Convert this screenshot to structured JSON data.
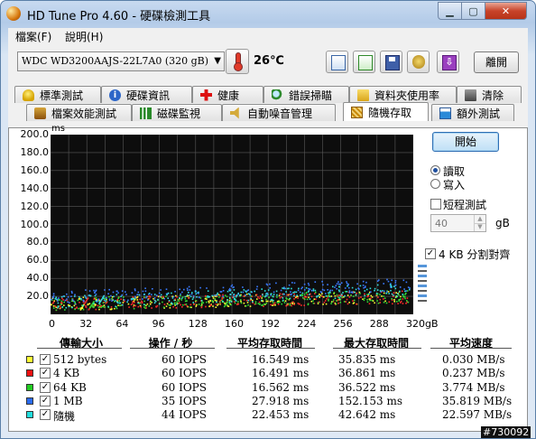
{
  "window": {
    "title": "HD Tune Pro 4.60 - 硬碟檢測工具"
  },
  "menu": [
    {
      "label": "檔案(F)"
    },
    {
      "label": "說明(H)"
    }
  ],
  "toolbar": {
    "drive": "WDC WD3200AAJS-22L7A0   (320 gB)",
    "temperature": "26℃",
    "exit_label": "離開",
    "icons": [
      "copy-text-icon",
      "copy-screenshot-icon",
      "save-icon",
      "options-icon",
      "download-icon"
    ]
  },
  "tabs_row1": [
    {
      "label": "標準測試",
      "icon": "bulb-icon"
    },
    {
      "label": "硬碟資訊",
      "icon": "info-icon"
    },
    {
      "label": "健康",
      "icon": "health-cross-icon"
    },
    {
      "label": "錯誤掃瞄",
      "icon": "scan-icon"
    },
    {
      "label": "資料夾使用率",
      "icon": "folder-icon"
    },
    {
      "label": "清除",
      "icon": "trash-icon"
    }
  ],
  "tabs_row2": [
    {
      "label": "檔案效能測試",
      "icon": "benchmark-icon"
    },
    {
      "label": "磁碟監視",
      "icon": "monitor-icon"
    },
    {
      "label": "自動噪音管理",
      "icon": "speaker-icon"
    },
    {
      "label": "隨機存取",
      "icon": "random-access-icon",
      "active": true
    },
    {
      "label": "額外測試",
      "icon": "extra-tests-icon"
    }
  ],
  "controls": {
    "start_label": "開始",
    "read_label": "讀取",
    "write_label": "寫入",
    "selected_mode": "read",
    "short_test_label": "短程測試",
    "short_test_checked": false,
    "short_test_value": "40",
    "short_test_unit": "gB",
    "align_label": "4 KB 分割對齊",
    "align_checked": true
  },
  "chart_data": {
    "type": "scatter",
    "y_unit": "ms",
    "ylim": [
      0,
      200
    ],
    "y_ticks": [
      "200.0",
      "180.0",
      "160.0",
      "140.0",
      "120.0",
      "100.0",
      "80.0",
      "60.0",
      "40.0",
      "20.0"
    ],
    "xlim": [
      0,
      320
    ],
    "x_ticks": [
      "0",
      "32",
      "64",
      "96",
      "128",
      "160",
      "192",
      "224",
      "256",
      "288",
      "320gB"
    ],
    "grid": true,
    "series": [
      {
        "name": "512 bytes",
        "color": "#ffff33",
        "y_start": 12,
        "y_end": 20
      },
      {
        "name": "4 KB",
        "color": "#ff2a2a",
        "y_start": 12,
        "y_end": 20
      },
      {
        "name": "64 KB",
        "color": "#33dd33",
        "y_start": 12,
        "y_end": 21
      },
      {
        "name": "1 MB",
        "color": "#3a7bff",
        "y_start": 20,
        "y_end": 34
      },
      {
        "name": "隨機",
        "color": "#33dddd",
        "y_start": 14,
        "y_end": 28
      }
    ]
  },
  "table": {
    "headers": [
      "傳輸大小",
      "操作 / 秒",
      "平均存取時間",
      "最大存取時間",
      "平均速度"
    ],
    "rows": [
      {
        "size": "512 bytes",
        "color": "#ffff33",
        "iops": "60 IOPS",
        "avg": "16.549 ms",
        "max": "35.835 ms",
        "speed": "0.030 MB/s"
      },
      {
        "size": "4 KB",
        "color": "#ee1111",
        "iops": "60 IOPS",
        "avg": "16.491 ms",
        "max": "36.861 ms",
        "speed": "0.237 MB/s"
      },
      {
        "size": "64 KB",
        "color": "#22cc22",
        "iops": "60 IOPS",
        "avg": "16.562 ms",
        "max": "36.522 ms",
        "speed": "3.774 MB/s"
      },
      {
        "size": "1 MB",
        "color": "#2a6bf0",
        "iops": "35 IOPS",
        "avg": "27.918 ms",
        "max": "152.153 ms",
        "speed": "35.819 MB/s"
      },
      {
        "size": "隨機",
        "color": "#22dddd",
        "iops": "44 IOPS",
        "avg": "22.453 ms",
        "max": "42.642 ms",
        "speed": "22.597 MB/s"
      }
    ]
  },
  "watermark": "#730092"
}
